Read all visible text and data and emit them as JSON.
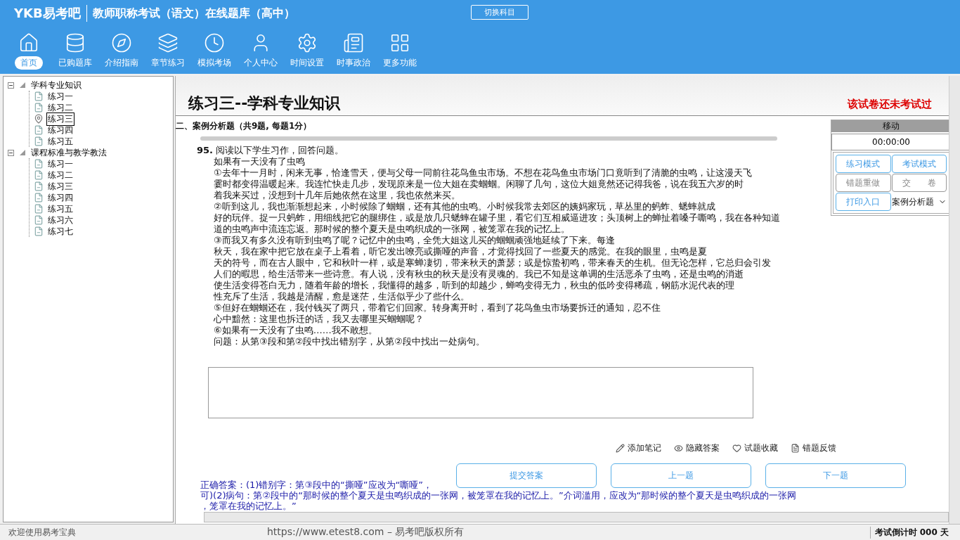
{
  "header": {
    "logo": "YKB易考吧",
    "title": "教师职称考试（语文）在线题库（高中）",
    "switch_button": "切换科目"
  },
  "nav": [
    {
      "label": "首页",
      "kind": "home",
      "selected": true
    },
    {
      "label": "已购题库",
      "kind": "database",
      "selected": false
    },
    {
      "label": "介绍指南",
      "kind": "compass",
      "selected": false
    },
    {
      "label": "章节练习",
      "kind": "layers",
      "selected": false
    },
    {
      "label": "模拟考场",
      "kind": "clock",
      "selected": false
    },
    {
      "label": "个人中心",
      "kind": "user",
      "selected": false
    },
    {
      "label": "时间设置",
      "kind": "settings",
      "selected": false
    },
    {
      "label": "时事政治",
      "kind": "news",
      "selected": false
    },
    {
      "label": "更多功能",
      "kind": "grid",
      "selected": false
    }
  ],
  "tree": [
    {
      "label": "学科专业知识",
      "expanded": true,
      "children": [
        {
          "label": "练习一",
          "selected": false
        },
        {
          "label": "练习二",
          "selected": false
        },
        {
          "label": "练习三",
          "selected": true
        },
        {
          "label": "练习四",
          "selected": false
        },
        {
          "label": "练习五",
          "selected": false
        }
      ]
    },
    {
      "label": "课程标准与教学教法",
      "expanded": true,
      "children": [
        {
          "label": "练习一",
          "selected": false
        },
        {
          "label": "练习二",
          "selected": false
        },
        {
          "label": "练习三",
          "selected": false
        },
        {
          "label": "练习四",
          "selected": false
        },
        {
          "label": "练习五",
          "selected": false
        },
        {
          "label": "练习六",
          "selected": false
        },
        {
          "label": "练习七",
          "selected": false
        }
      ]
    }
  ],
  "exam": {
    "title": "练习三--学科专业知识",
    "status": "该试卷还未考试过",
    "section": "二、案例分析题（共9题, 每题1分）"
  },
  "question": {
    "number": "95.",
    "prompt": "阅读以下学生习作，回答问题。",
    "lines": [
      "如果有一天没有了虫鸣",
      "①去年十一月时，闲来无事，恰逢雪天，便与父母一同前往花鸟鱼虫市场。不想在花鸟鱼虫市场门口竟听到了清脆的虫鸣，让这漫天飞",
      "霎时都变得温暖起来。我连忙快走几步，发现原来是一位大姐在卖蝈蝈。闲聊了几句，这位大姐竟然还记得我爸，说在我五六岁的时",
      "着我来买过，没想到十几年后她依然在这里，我也依然来买。",
      "②听到这儿，我也渐渐想起来，小时候除了蝈蝈，还有其他的虫鸣。小时候我常去郊区的姨妈家玩，草丛里的蚂蚱、蟋蟀就成",
      "好的玩伴。捉一只蚂蚱，用细线把它的腿绑住，或是放几只蟋蟀在罐子里，看它们互相威逼进攻；头顶树上的蝉扯着嗓子嘶鸣，我在各种知道",
      "道的虫鸣声中流连忘返。那时候的整个夏天是虫鸣织成的一张网，被笼罩在我的记忆上。",
      "③而我又有多久没有听到虫鸣了呢？记忆中的虫鸣，全凭大姐这儿买的蝈蝈顽强地延续了下来。每逢",
      "秋天，我在家中把它放在桌子上看着，听它发出嘹亮或撕哑的声音，才觉得找回了一些夏天的感觉。在我的眼里，虫鸣是夏",
      "天的符号，而在古人眼中，它和秋叶一样，或是寒蝉凄切，带来秋天的萧瑟；或是惊蛰初鸣，带来春天的生机。但无论怎样，它总归会引发",
      "人们的暇思，给生活带来一些诗意。有人说，没有秋虫的秋天是没有灵魂的。我已不知是这单调的生活恶杀了虫鸣，还是虫鸣的消逝",
      "使生活变得苍白无力，随着年龄的增长，我懂得的越多，听到的却越少，蝉鸣变得无力，秋虫的低吟变得稀疏，钢筋水泥代表的理",
      "性充斥了生活，我越是清醒，愈是迷茫，生活似乎少了些什么。",
      "⑤但好在蝈蝈还在，我付钱买了两只，带着它们回家。转身离开时，看到了花鸟鱼虫市场要拆迁的通知，忍不住",
      "心中黯然：这里也拆迁的话，我又去哪里买蝈蝈呢？",
      "⑥如果有一天没有了虫鸣……我不敢想。",
      "问题：从第③段和第②段中找出错别字，从第②段中找出一处病句。"
    ]
  },
  "tools": [
    {
      "label": "添加笔记",
      "kind": "note"
    },
    {
      "label": "隐藏答案",
      "kind": "hide"
    },
    {
      "label": "试题收藏",
      "kind": "favorite"
    },
    {
      "label": "错题反馈",
      "kind": "feedback"
    }
  ],
  "answer_lines": [
    "正确答案：(1)错别字：第③段中的“撕哑”应改为“嘶哑”，",
    "可)(2)病句：第②段中的“那时候的整个夏天是虫鸣织成的一张网，被笼罩在我的记忆上。”介词滥用，应改为“那时候的整个夏天是虫鸣织成的一张网",
    "，笼罩在我的记忆上。”"
  ],
  "nav_buttons": [
    "提交答案",
    "上一题",
    "下一题"
  ],
  "panel": {
    "move_label": "移动",
    "timer": "00:00:00",
    "buttons": [
      {
        "label": "练习模式",
        "disabled": false
      },
      {
        "label": "考试模式",
        "disabled": false
      },
      {
        "label": "错题重做",
        "disabled": true
      },
      {
        "label": "交　　卷",
        "disabled": true
      },
      {
        "label": "打印入口",
        "disabled": false
      }
    ],
    "type_select": "案例分析题"
  },
  "status_bar": {
    "welcome": "欢迎使用易考宝典",
    "copyright": "https://www.etest8.com – 易考吧版权所有",
    "countdown": "考试倒计时 000 天"
  }
}
